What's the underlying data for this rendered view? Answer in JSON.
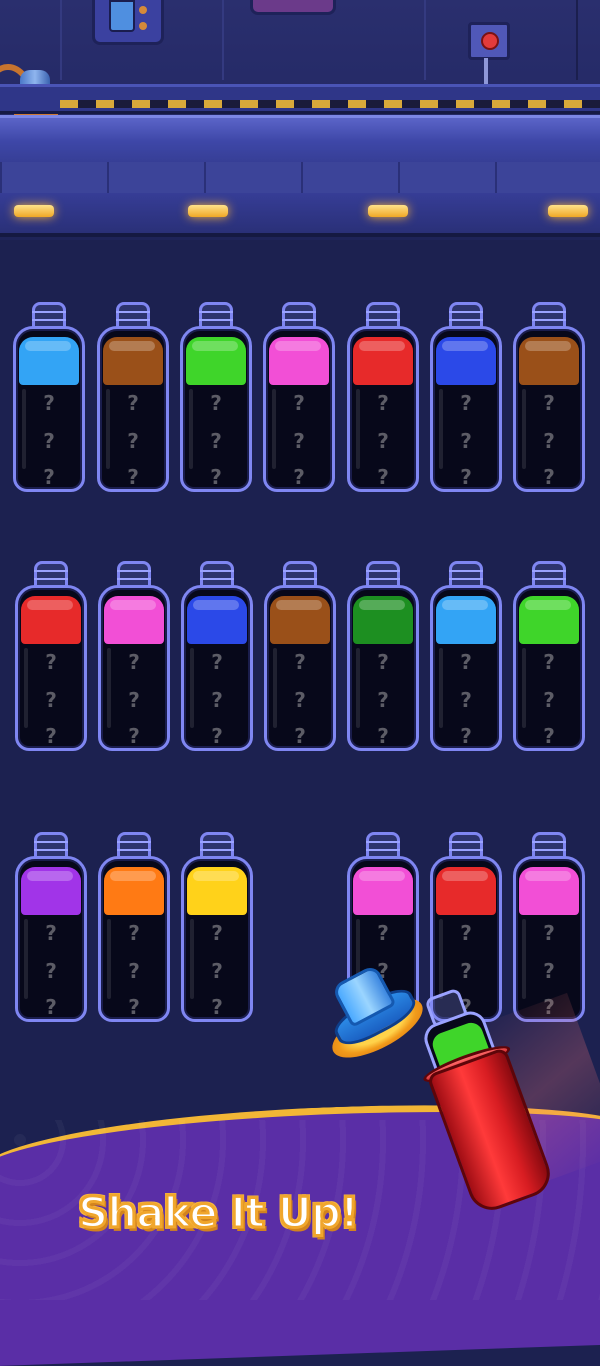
{
  "banner": {
    "slogan": "Shake It Up!"
  },
  "bottles": [
    {
      "color": "#33a4f5",
      "hidden": [
        "?",
        "?",
        "?"
      ]
    },
    {
      "color": "#9a5019",
      "hidden": [
        "?",
        "?",
        "?"
      ]
    },
    {
      "color": "#3fd52a",
      "hidden": [
        "?",
        "?",
        "?"
      ]
    },
    {
      "color": "#f24fd6",
      "hidden": [
        "?",
        "?",
        "?"
      ]
    },
    {
      "color": "#e72a2a",
      "hidden": [
        "?",
        "?",
        "?"
      ]
    },
    {
      "color": "#2b49e8",
      "hidden": [
        "?",
        "?",
        "?"
      ]
    },
    {
      "color": "#9a5019",
      "hidden": [
        "?",
        "?",
        "?"
      ]
    },
    {
      "color": "#e72a2a",
      "hidden": [
        "?",
        "?",
        "?"
      ]
    },
    {
      "color": "#f24fd6",
      "hidden": [
        "?",
        "?",
        "?"
      ]
    },
    {
      "color": "#2b49e8",
      "hidden": [
        "?",
        "?",
        "?"
      ]
    },
    {
      "color": "#9a5019",
      "hidden": [
        "?",
        "?",
        "?"
      ]
    },
    {
      "color": "#1d8f21",
      "hidden": [
        "?",
        "?",
        "?"
      ]
    },
    {
      "color": "#33a4f5",
      "hidden": [
        "?",
        "?",
        "?"
      ]
    },
    {
      "color": "#3fd52a",
      "hidden": [
        "?",
        "?",
        "?"
      ]
    },
    {
      "color": "#a134e8",
      "hidden": [
        "?",
        "?",
        "?"
      ]
    },
    {
      "color": "#ff7a14",
      "hidden": [
        "?",
        "?",
        "?"
      ]
    },
    {
      "color": "#ffd21a",
      "hidden": [
        "?",
        "?",
        "?"
      ]
    },
    {
      "color": "#f24fd6",
      "hidden": [
        "?",
        "?",
        "?"
      ]
    },
    {
      "color": "#e72a2a",
      "hidden": [
        "?",
        "?",
        "?"
      ]
    },
    {
      "color": "#f24fd6",
      "hidden": [
        "?",
        "?",
        "?"
      ]
    }
  ],
  "shaker_tube": {
    "color": "#3fd52a"
  },
  "colors": {
    "background": "#1c2150",
    "glass": "#7f86f2",
    "banner": "#5a2ea6",
    "banner_trim": "#f2b636"
  }
}
